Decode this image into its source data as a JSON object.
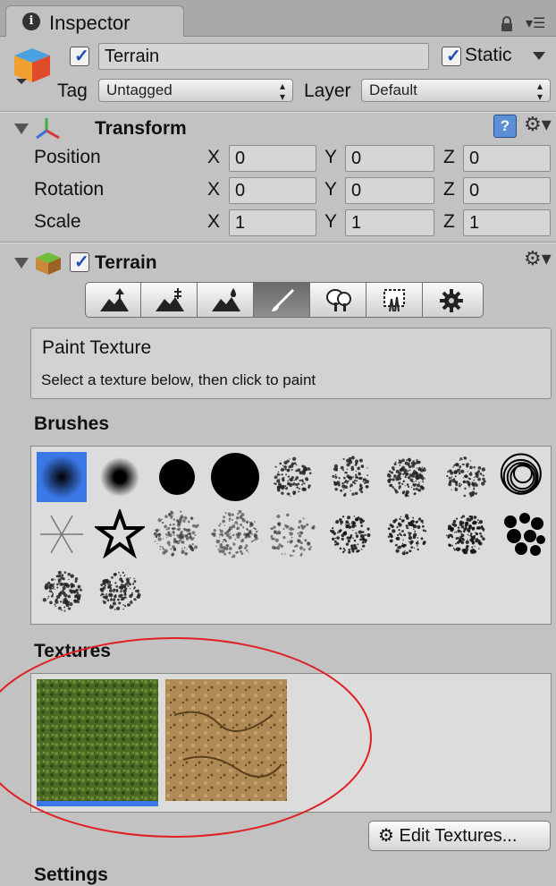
{
  "tab": {
    "title": "Inspector",
    "info_icon": "i"
  },
  "object": {
    "name": "Terrain",
    "active": true,
    "static_label": "Static",
    "static_checked": true,
    "tag_label": "Tag",
    "tag_value": "Untagged",
    "layer_label": "Layer",
    "layer_value": "Default"
  },
  "transform": {
    "title": "Transform",
    "rows": [
      {
        "label": "Position",
        "x": "0",
        "y": "0",
        "z": "0"
      },
      {
        "label": "Rotation",
        "x": "0",
        "y": "0",
        "z": "0"
      },
      {
        "label": "Scale",
        "x": "1",
        "y": "1",
        "z": "1"
      }
    ],
    "axis_x": "X",
    "axis_y": "Y",
    "axis_z": "Z"
  },
  "terrain": {
    "title": "Terrain",
    "enabled": true,
    "tools": [
      "raise-lower-icon",
      "paint-height-icon",
      "smooth-height-icon",
      "paint-texture-icon",
      "place-trees-icon",
      "paint-details-icon",
      "settings-icon"
    ],
    "selected_tool": 3,
    "info_title": "Paint Texture",
    "info_desc": "Select a texture below, then click to paint",
    "brushes_label": "Brushes",
    "textures_label": "Textures",
    "edit_textures_label": "Edit Textures...",
    "settings_label": "Settings"
  },
  "colors": {
    "selection": "#3b78e7",
    "annotation": "#e02020"
  }
}
